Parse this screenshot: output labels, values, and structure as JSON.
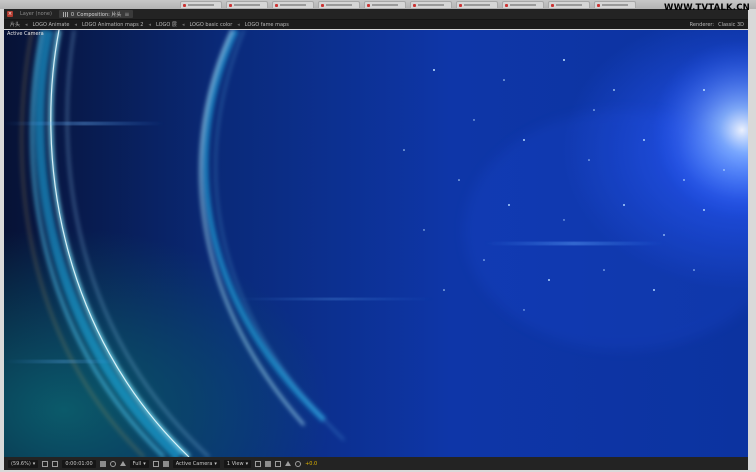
{
  "watermark": {
    "text": "WWW.TVTALK.CN"
  },
  "panel_tabs": [
    {
      "label": "Layer (none)",
      "active": false
    },
    {
      "label": "Composition: 片头",
      "active": true
    }
  ],
  "flowchart": {
    "comp": "片头",
    "items": [
      "LOGO Animate",
      "LOGO Animation maps 2",
      "LOGO 层",
      "LOGO basic color",
      "LOGO fame maps"
    ],
    "renderer_label": "Renderer:",
    "renderer_value": "Classic 3D"
  },
  "viewer": {
    "camera_label": "Active Camera",
    "colors": {
      "bg_dark": "#071235",
      "bg_mid": "#0e36a8",
      "glow": "#3f7cff",
      "ring": "#7fe8ff"
    }
  },
  "bottom_bar": {
    "magnification": "(59.6%)",
    "timecode": "0:00:01:00",
    "resolution": "Full",
    "camera": "Active Camera",
    "view_count": "1 View",
    "exposure": "+0.0"
  }
}
